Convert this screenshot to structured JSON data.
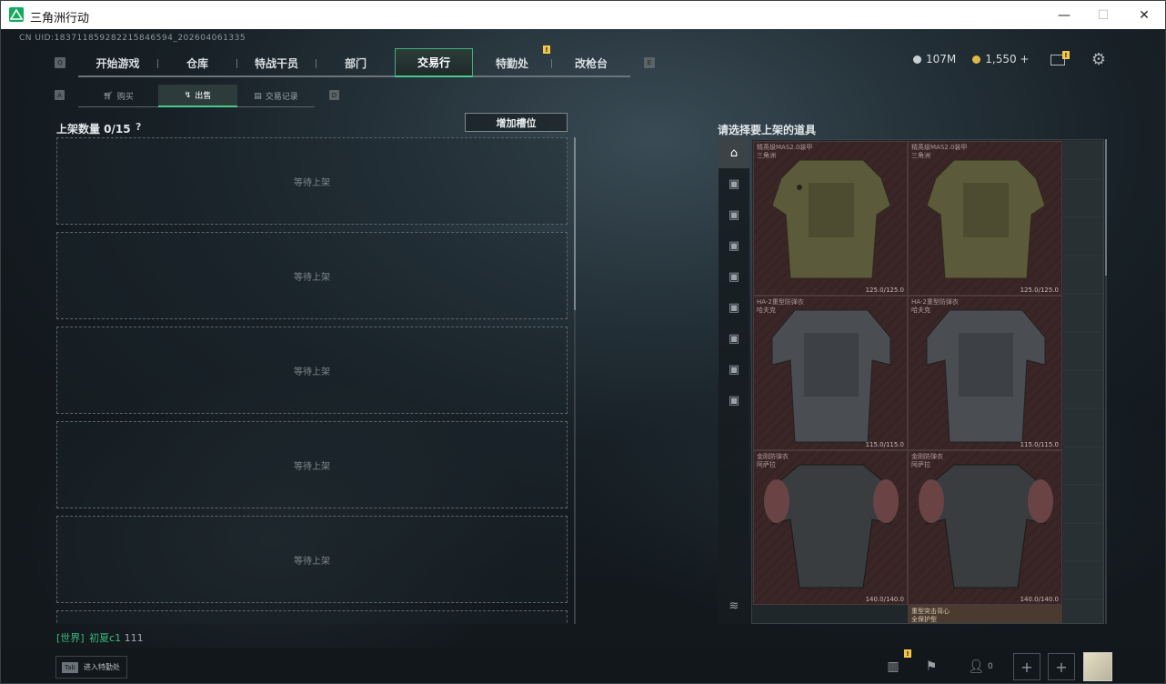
{
  "window": {
    "title": "三角洲行动",
    "minimize": "—",
    "maximize": "☐",
    "close": "✕"
  },
  "uid": "CN UID:1837118592822158465​94_202604061335",
  "top_nav": {
    "left_key": "Q",
    "right_key": "E",
    "tabs": [
      {
        "label": "开始游戏"
      },
      {
        "label": "仓库"
      },
      {
        "label": "特战干员"
      },
      {
        "label": "部门"
      },
      {
        "label": "交易行",
        "active": true
      },
      {
        "label": "特勤处",
        "alert": true
      },
      {
        "label": "改枪台"
      }
    ]
  },
  "currency": {
    "silver": "107M",
    "gold": "1,550 +"
  },
  "sub_nav": {
    "left_key": "A",
    "right_key": "D",
    "tabs": [
      {
        "label": "购买"
      },
      {
        "label": "出售",
        "active": true
      },
      {
        "label": "交易记录"
      }
    ]
  },
  "left_panel": {
    "title": "上架数量 0/15",
    "help": "?",
    "add_slot": "增加槽位",
    "slots": [
      "等待上架",
      "等待上架",
      "等待上架",
      "等待上架",
      "等待上架"
    ]
  },
  "chat": {
    "channel": "[世界]",
    "user": "初夏c1",
    "message": "111"
  },
  "right_panel": {
    "title": "请选择要上架的道具",
    "categories": [
      "helmet-category-icon",
      "armor-category-icon",
      "chest-rig-category-icon",
      "backpack-category-icon",
      "weapon-category-icon",
      "ammo-category-icon",
      "medical-category-icon",
      "key-category-icon",
      "misc-category-icon"
    ],
    "items": [
      {
        "name": "精英级MAS2.0装甲",
        "sub": "三角洲",
        "durability": "125.0/125.0"
      },
      {
        "name": "精英级MAS2.0装甲",
        "sub": "三角洲",
        "durability": "125.0/125.0"
      },
      {
        "name": "HA-2重型防弹衣",
        "sub": "哈夫克",
        "durability": "115.0/115.0"
      },
      {
        "name": "HA-2重型防弹衣",
        "sub": "哈夫克",
        "durability": "115.0/115.0"
      },
      {
        "name": "金刚防弹衣",
        "sub": "阿萨拉",
        "durability": "140.0/140.0"
      },
      {
        "name": "金刚防弹衣",
        "sub": "阿萨拉",
        "durability": "140.0/140.0"
      }
    ],
    "peek_item": {
      "name": "重型突击背心",
      "sub": "全保护型"
    }
  },
  "bottom_bar": {
    "tab_key": "Tab",
    "tab_label": "进入特勤处",
    "friends_count": "0"
  },
  "colors": {
    "accent": "#4ac98e",
    "alert": "#f2c94c",
    "item_bg": "#3a2626"
  }
}
